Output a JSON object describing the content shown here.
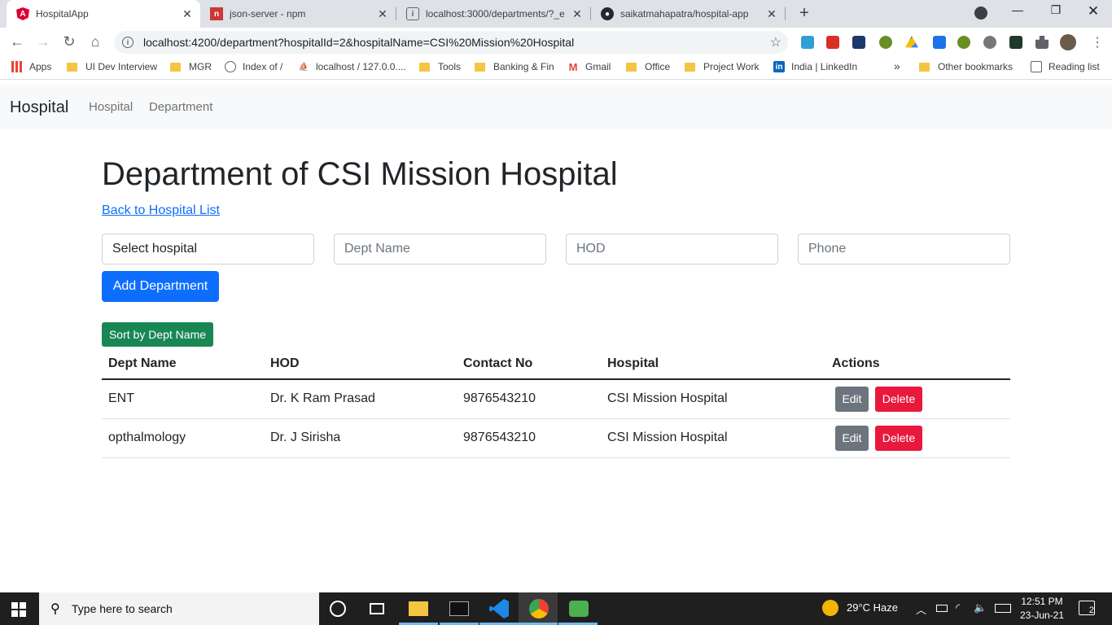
{
  "browser": {
    "tabs": [
      {
        "title": "HospitalApp",
        "active": true
      },
      {
        "title": "json-server - npm",
        "active": false
      },
      {
        "title": "localhost:3000/departments/?_ex",
        "active": false
      },
      {
        "title": "saikatmahapatra/hospital-app",
        "active": false
      }
    ],
    "url": "localhost:4200/department?hospitalId=2&hospitalName=CSI%20Mission%20Hospital",
    "bookmarks": {
      "apps": "Apps",
      "ui_dev": "UI Dev Interview",
      "mgr": "MGR",
      "index_of": "Index of /",
      "localhost": "localhost / 127.0.0....",
      "tools": "Tools",
      "banking": "Banking & Fin",
      "gmail": "Gmail",
      "office": "Office",
      "project_work": "Project Work",
      "linkedin": "India | LinkedIn",
      "more": "»",
      "other": "Other bookmarks",
      "reading": "Reading list"
    }
  },
  "nav": {
    "brand": "Hospital",
    "links": [
      "Hospital",
      "Department"
    ]
  },
  "page": {
    "title": "Department of CSI Mission Hospital",
    "back_link": "Back to Hospital List"
  },
  "form": {
    "hospital_select": "Select hospital",
    "dept_placeholder": "Dept Name",
    "hod_placeholder": "HOD",
    "phone_placeholder": "Phone",
    "add_button": "Add Department"
  },
  "sort_button": "Sort by Dept Name",
  "table": {
    "headers": [
      "Dept Name",
      "HOD",
      "Contact No",
      "Hospital",
      "Actions"
    ],
    "rows": [
      {
        "dept": "ENT",
        "hod": "Dr. K Ram Prasad",
        "contact": "9876543210",
        "hospital": "CSI Mission Hospital"
      },
      {
        "dept": "opthalmology",
        "hod": "Dr. J Sirisha",
        "contact": "9876543210",
        "hospital": "CSI Mission Hospital"
      }
    ],
    "edit_label": "Edit",
    "delete_label": "Delete"
  },
  "taskbar": {
    "search_placeholder": "Type here to search",
    "weather": "29°C  Haze",
    "time": "12:51 PM",
    "date": "23-Jun-21",
    "notifications": "2"
  },
  "colors": {
    "primary": "#0d6efd",
    "success": "#198754",
    "danger": "#e8193c",
    "secondary": "#6c757d"
  }
}
